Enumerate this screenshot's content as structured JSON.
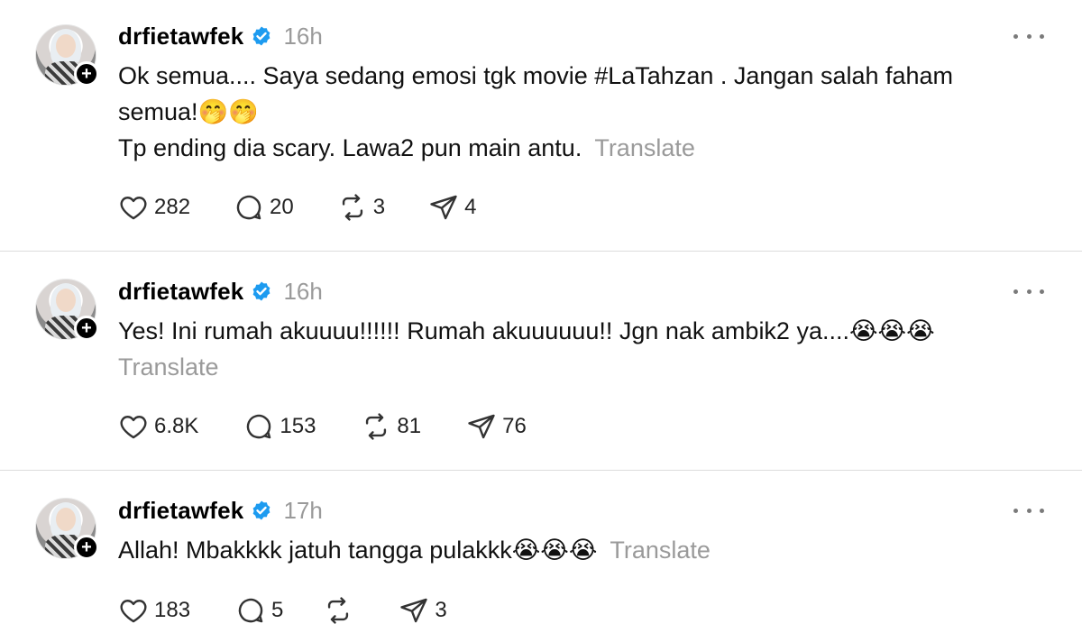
{
  "posts": [
    {
      "username": "drfietawfek",
      "time": "16h",
      "text_lines": [
        "Ok semua.... Saya sedang emosi tgk movie #LaTahzan . Jangan salah faham",
        "semua!🤭🤭",
        "Tp ending dia scary. Lawa2 pun main antu."
      ],
      "translate": "Translate",
      "likes": "282",
      "comments": "20",
      "reposts": "3",
      "shares": "4"
    },
    {
      "username": "drfietawfek",
      "time": "16h",
      "text_lines": [
        "Yes! Ini rumah akuuuu!!!!!! Rumah akuuuuuu!! Jgn nak ambik2 ya....😭😭😭"
      ],
      "translate": "Translate",
      "likes": "6.8K",
      "comments": "153",
      "reposts": "81",
      "shares": "76"
    },
    {
      "username": "drfietawfek",
      "time": "17h",
      "text_lines": [
        "Allah! Mbakkkk jatuh tangga pulakkk😭😭😭"
      ],
      "translate": "Translate",
      "likes": "183",
      "comments": "5",
      "reposts": "",
      "shares": "3"
    }
  ],
  "colors": {
    "verified": "#1d9bf0",
    "muted": "#9a9a9a",
    "divider": "#dcdcdc"
  },
  "icons": [
    "heart-icon",
    "comment-icon",
    "repost-icon",
    "share-icon",
    "more-icon",
    "verified-icon",
    "follow-plus-icon"
  ]
}
